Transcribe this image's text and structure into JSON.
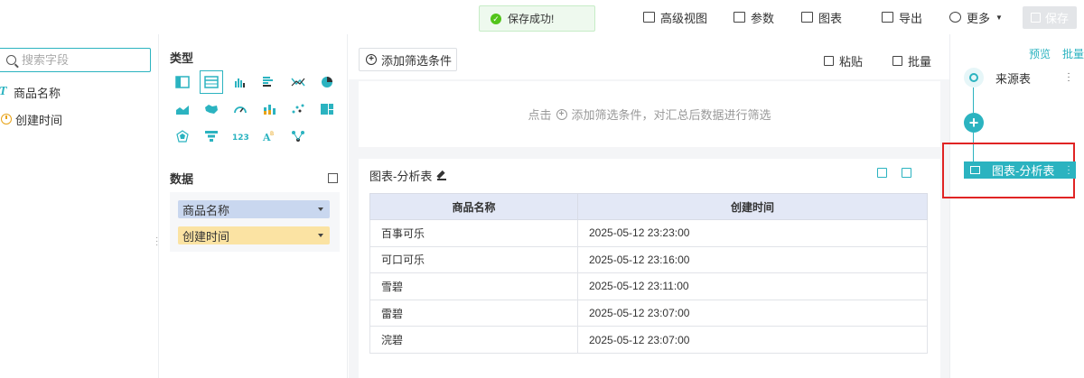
{
  "toast": {
    "message": "保存成功!"
  },
  "toolbar": {
    "advanced_view": "高级视图",
    "params": "参数",
    "chart": "图表",
    "export": "导出",
    "more": "更多",
    "save": "保存"
  },
  "fields": {
    "search_placeholder": "搜索字段",
    "items": [
      {
        "label": "商品名称",
        "type": "text"
      },
      {
        "label": "创建时间",
        "type": "datetime"
      }
    ]
  },
  "type_panel": {
    "title": "类型",
    "chart_types": [
      "grouped-table-icon",
      "detail-table-icon",
      "bar-chart-icon",
      "horizontal-bar-icon",
      "line-chart-icon",
      "pie-chart-icon",
      "area-chart-icon",
      "map-icon",
      "gauge-icon",
      "stacked-bar-icon",
      "scatter-icon",
      "rect-tree-icon",
      "radar-icon",
      "funnel-icon",
      "kpi-number-icon",
      "word-cloud-icon",
      "network-icon"
    ],
    "selected_index": 1,
    "data_title": "数据",
    "data_fields": [
      "商品名称",
      "创建时间"
    ]
  },
  "filter": {
    "add_button": "添加筛选条件",
    "paste": "粘贴",
    "batch": "批量",
    "hint_prefix": "点击",
    "hint_suffix": "添加筛选条件，对汇总后数据进行筛选"
  },
  "table_card": {
    "title": "图表-分析表",
    "columns": [
      "商品名称",
      "创建时间"
    ],
    "rows": [
      [
        "百事可乐",
        "2025-05-12 23:23:00"
      ],
      [
        "可口可乐",
        "2025-05-12 23:16:00"
      ],
      [
        "雪碧",
        "2025-05-12 23:11:00"
      ],
      [
        "雷碧",
        "2025-05-12 23:07:00"
      ],
      [
        "浣碧",
        "2025-05-12 23:07:00"
      ]
    ]
  },
  "pipeline": {
    "preview": "预览",
    "batch": "批量",
    "source_node": "来源表",
    "analysis_node": "图表-分析表"
  },
  "colors": {
    "accent": "#2bb3c0",
    "highlight": "#e02424"
  }
}
